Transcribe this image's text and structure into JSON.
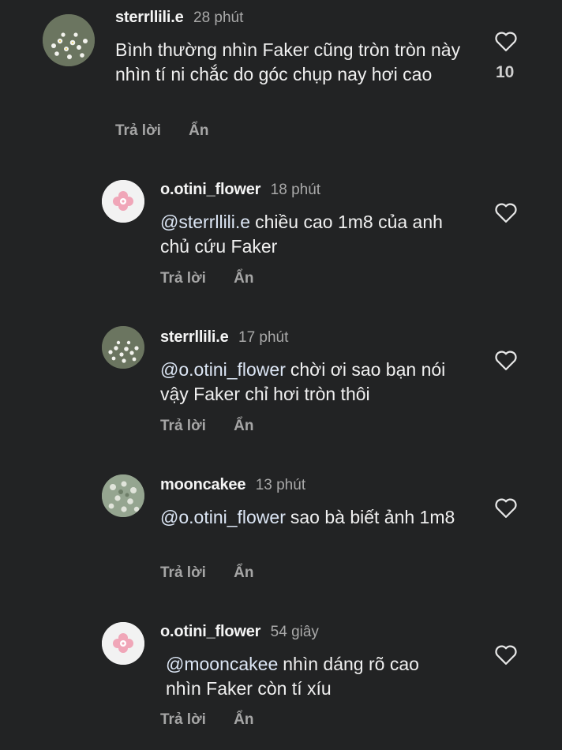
{
  "comments": [
    {
      "username": "sterrllili.e",
      "time": "28 phút",
      "mention": "",
      "text": "Bình thường nhìn Faker cũng tròn tròn này nhìn tí ni chắc do góc chụp nay hơi cao",
      "reply_label": "Trả lời",
      "hide_label": "Ẩn",
      "likes": "10",
      "avatar_icon": "flowers-avatar-icon"
    },
    {
      "username": "o.otini_flower",
      "time": "18 phút",
      "mention": "@sterrllili.e",
      "text": "chiều cao 1m8 của anh chủ cứu Faker",
      "reply_label": "Trả lời",
      "hide_label": "Ẩn",
      "likes": "",
      "avatar_icon": "pink-flower-avatar-icon"
    },
    {
      "username": "sterrllili.e",
      "time": "17 phút",
      "mention": "@o.otini_flower",
      "text": "chời ơi sao bạn nói vậy Faker chỉ hơi tròn thôi",
      "reply_label": "Trả lời",
      "hide_label": "Ẩn",
      "likes": "",
      "avatar_icon": "flowers-avatar-icon"
    },
    {
      "username": "mooncakee",
      "time": "13 phút",
      "mention": "@o.otini_flower",
      "text": "sao bà biết ảnh 1m8",
      "reply_label": "Trả lời",
      "hide_label": "Ẩn",
      "likes": "",
      "avatar_icon": "blossom-avatar-icon"
    },
    {
      "username": "o.otini_flower",
      "time": "54 giây",
      "mention": "@mooncakee",
      "text": "nhìn dáng rõ cao nhìn Faker còn tí xíu",
      "reply_label": "Trả lời",
      "hide_label": "Ẩn",
      "likes": "",
      "avatar_icon": "pink-flower-avatar-icon"
    }
  ],
  "colors": {
    "background": "#222324",
    "text": "#f0f0f0",
    "muted": "#a9a9a9",
    "mention": "#dce6f5"
  }
}
